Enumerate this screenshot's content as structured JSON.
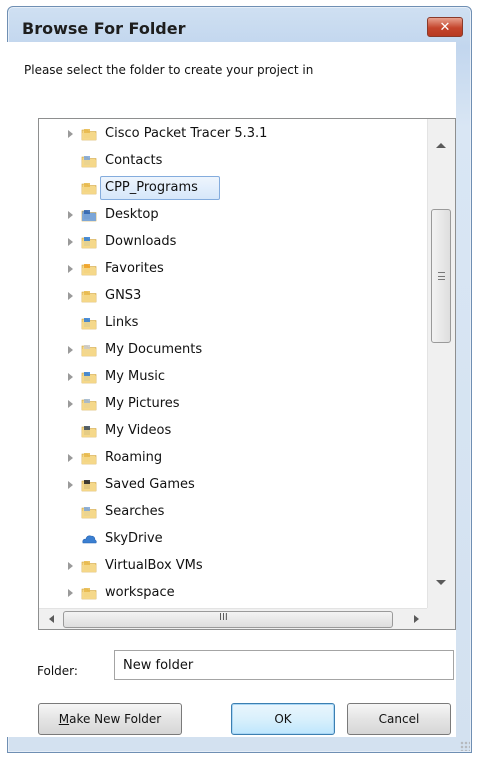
{
  "window": {
    "title": "Browse For Folder",
    "close_glyph": "✕",
    "colors": {
      "titlebar": "#c2d6ee",
      "close": "#c4452c",
      "selection": "#d6e7fa"
    }
  },
  "prompt": "Please select the folder to create your project in",
  "tree": {
    "items": [
      {
        "label": "Cisco Packet Tracer 5.3.1",
        "icon": "folder-icon",
        "expandable": true,
        "selected": false
      },
      {
        "label": "Contacts",
        "icon": "contacts-folder-icon",
        "expandable": false,
        "selected": false
      },
      {
        "label": "CPP_Programs",
        "icon": "folder-icon",
        "expandable": false,
        "selected": true
      },
      {
        "label": "Desktop",
        "icon": "desktop-folder-icon",
        "expandable": true,
        "selected": false
      },
      {
        "label": "Downloads",
        "icon": "downloads-folder-icon",
        "expandable": true,
        "selected": false
      },
      {
        "label": "Favorites",
        "icon": "favorites-folder-icon",
        "expandable": true,
        "selected": false
      },
      {
        "label": "GNS3",
        "icon": "folder-icon",
        "expandable": true,
        "selected": false
      },
      {
        "label": "Links",
        "icon": "links-folder-icon",
        "expandable": false,
        "selected": false
      },
      {
        "label": "My Documents",
        "icon": "documents-folder-icon",
        "expandable": true,
        "selected": false
      },
      {
        "label": "My Music",
        "icon": "music-folder-icon",
        "expandable": true,
        "selected": false
      },
      {
        "label": "My Pictures",
        "icon": "pictures-folder-icon",
        "expandable": true,
        "selected": false
      },
      {
        "label": "My Videos",
        "icon": "videos-folder-icon",
        "expandable": false,
        "selected": false
      },
      {
        "label": "Roaming",
        "icon": "folder-icon",
        "expandable": true,
        "selected": false
      },
      {
        "label": "Saved Games",
        "icon": "saved-games-folder-icon",
        "expandable": true,
        "selected": false
      },
      {
        "label": "Searches",
        "icon": "searches-folder-icon",
        "expandable": false,
        "selected": false
      },
      {
        "label": "SkyDrive",
        "icon": "skydrive-cloud-icon",
        "expandable": false,
        "selected": false
      },
      {
        "label": "VirtualBox VMs",
        "icon": "folder-icon",
        "expandable": true,
        "selected": false
      },
      {
        "label": "workspace",
        "icon": "folder-icon",
        "expandable": true,
        "selected": false
      }
    ],
    "hscroll_grip": "III",
    "vscroll_grip": "≡"
  },
  "folder": {
    "label": "Folder:",
    "value": "New folder"
  },
  "buttons": {
    "make_new_folder": "Make New Folder",
    "ok": "OK",
    "cancel": "Cancel"
  }
}
